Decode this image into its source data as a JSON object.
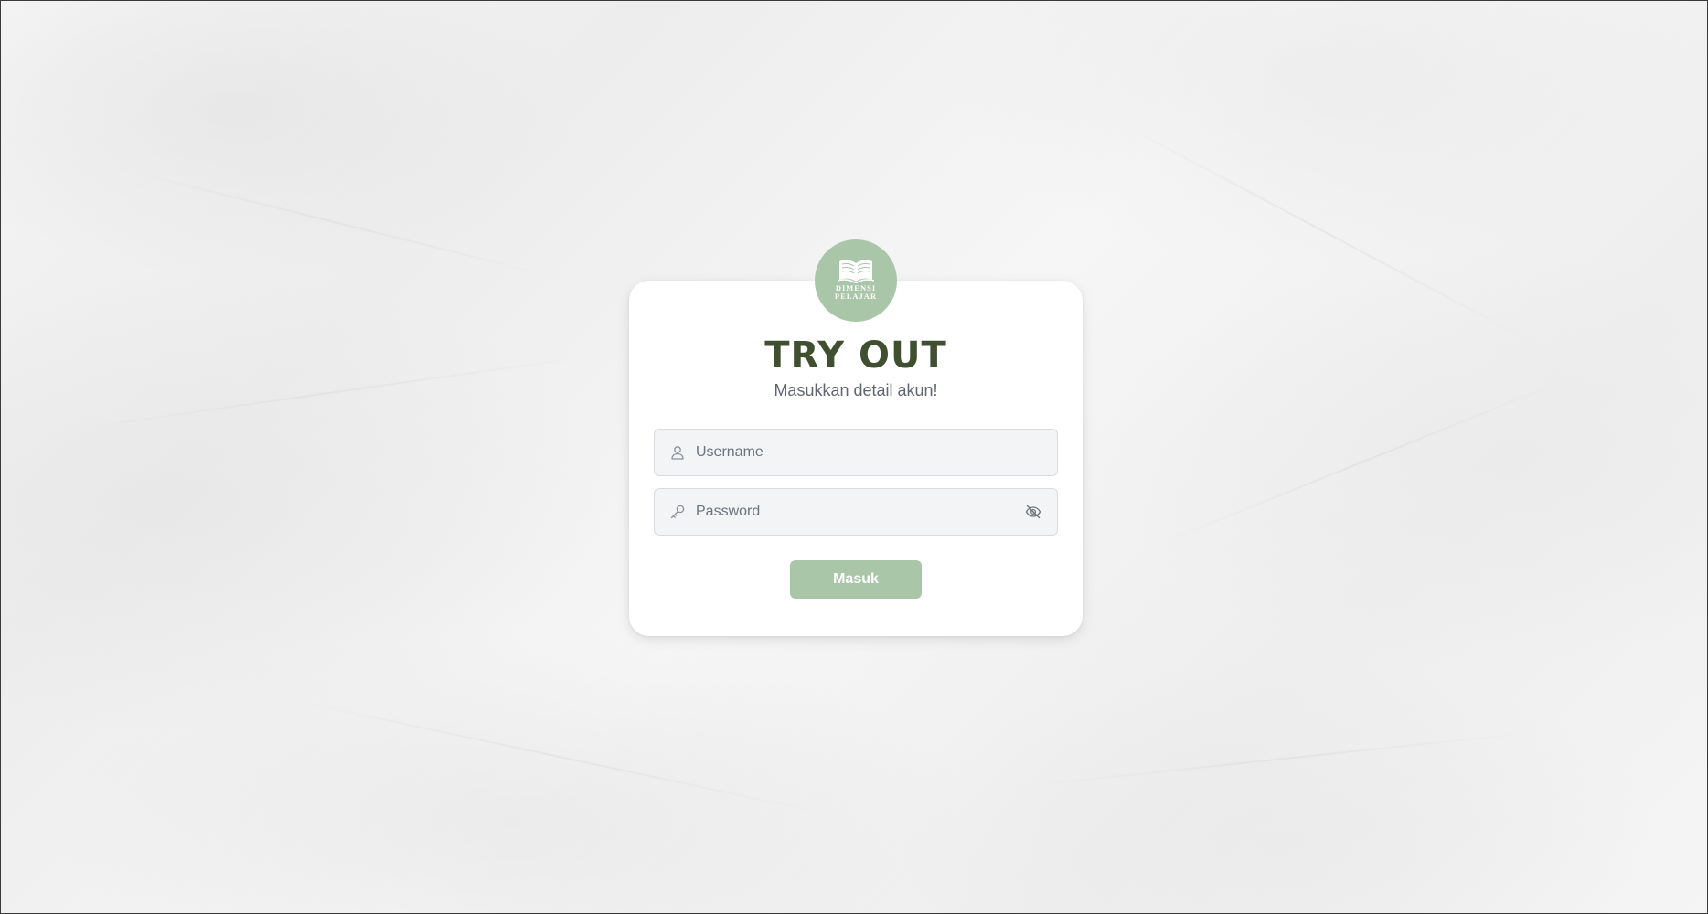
{
  "background": {
    "color": "#f2f2f2"
  },
  "logo": {
    "icon": "open-book-icon",
    "line1": "DIMENSI",
    "line2": "PELAJAR",
    "color": "#a9c6a8"
  },
  "login": {
    "title": "TRY OUT",
    "subtitle": "Masukkan detail akun!",
    "username": {
      "placeholder": "Username",
      "value": "",
      "icon": "user-icon"
    },
    "password": {
      "placeholder": "Password",
      "value": "",
      "icon": "key-icon",
      "toggle_icon": "eye-off-icon"
    },
    "submit_label": "Masuk"
  },
  "colors": {
    "accent": "#a9c6a8",
    "title": "#3f4f30",
    "subtitle": "#5f6573",
    "field_bg": "#f3f4f6"
  }
}
